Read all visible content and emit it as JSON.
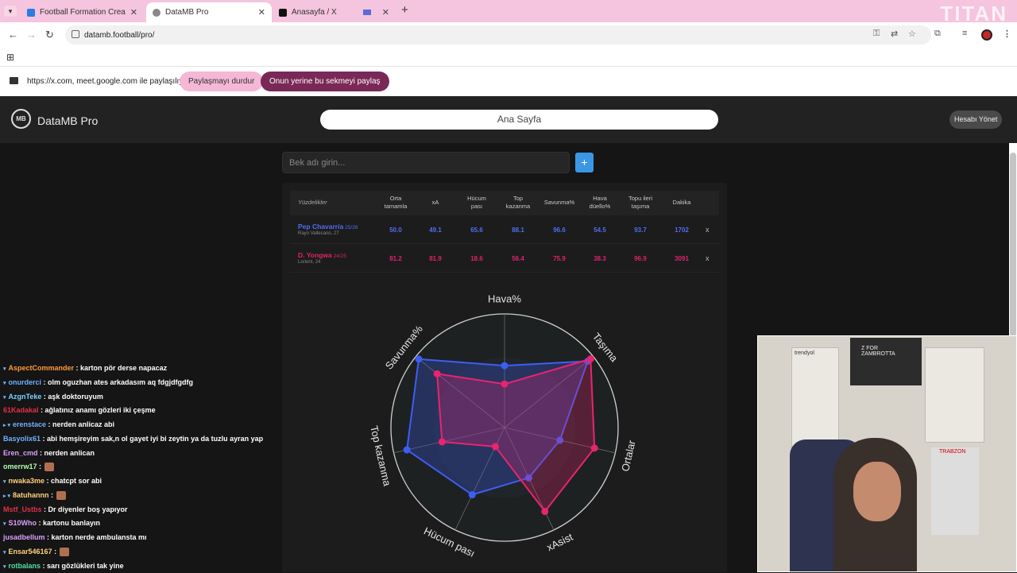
{
  "browser": {
    "tabs": [
      {
        "title": "Football Formation Creator: Re",
        "fav": "#2a7be4",
        "active": false
      },
      {
        "title": "DataMB Pro",
        "fav": "#888888",
        "active": true
      },
      {
        "title": "Anasayfa / X",
        "fav": "#111111",
        "active": false
      }
    ],
    "url": "datamb.football/pro/",
    "watermark": "TITAN"
  },
  "share": {
    "text": "https://x.com, meet.google.com ile paylaşılıyor",
    "stop": "Paylaşmayı durdur",
    "switch": "Onun yerine bu sekmeyi paylaş"
  },
  "site": {
    "logo": "MB",
    "brand": "DataMB Pro",
    "home": "Ana Sayfa",
    "account": "Hesabı Yönet"
  },
  "search": {
    "placeholder": "Bek adı girin...",
    "add": "+"
  },
  "table": {
    "header_first": "Yüzdelikler",
    "columns": [
      "Orta tamamla",
      "xA",
      "Hücum pası",
      "Top kazanma",
      "Savunma%",
      "Hava düello%",
      "Topu ileri taşıma",
      "Dakika"
    ],
    "rows": [
      {
        "name": "Pep Chavarría",
        "season": "25/26",
        "club": "Rayo Vallecano, 27",
        "color": "#4f6ef0",
        "values": [
          "50.0",
          "49.1",
          "65.6",
          "88.1",
          "96.6",
          "54.5",
          "93.7",
          "1702"
        ],
        "remove": "x"
      },
      {
        "name": "D. Yongwa",
        "season": "24/25",
        "club": "Lorient, 24",
        "color": "#e0226e",
        "values": [
          "81.2",
          "81.9",
          "18.6",
          "56.4",
          "75.9",
          "38.3",
          "96.9",
          "3091"
        ],
        "remove": "x"
      }
    ]
  },
  "chart_data": {
    "type": "radar",
    "axes": [
      "Hava%",
      "Taşıma",
      "Ortalar",
      "xAsist",
      "Hücum pası",
      "Top kazanma",
      "Savunma%"
    ],
    "range": [
      0,
      100
    ],
    "series": [
      {
        "name": "Pep Chavarría",
        "color": "#3d5ef5",
        "values": [
          54.5,
          93.7,
          50.0,
          49.1,
          65.6,
          88.1,
          96.6
        ]
      },
      {
        "name": "D. Yongwa",
        "color": "#e8246f",
        "values": [
          38.3,
          96.9,
          81.2,
          81.9,
          18.6,
          56.4,
          75.9
        ]
      }
    ]
  },
  "chat": [
    {
      "user": "AspectCommander",
      "color": "#ff9a3c",
      "text": ": karton pör derse napacaz",
      "mark": "▾"
    },
    {
      "user": "onurderci",
      "color": "#6fb1ff",
      "text": ": olm oguzhan ates arkadasım aq fdgjdfgdfg",
      "mark": "▾"
    },
    {
      "user": "AzgnTeke",
      "color": "#7ad0ff",
      "text": ": aşk doktoruyum",
      "mark": "▾"
    },
    {
      "user": "61Kadakal",
      "color": "#e0304a",
      "text": ": ağlatınız anamı gözleri iki çeşme",
      "mark": ""
    },
    {
      "user": "erenstace",
      "color": "#6fb1ff",
      "text": ": nerden anlicaz abi",
      "mark": "▸ ▾"
    },
    {
      "user": "Basyolix61",
      "color": "#6fb1ff",
      "text": ": abi hemşireyim sak,n ol gayet iyi bi zeytin ya da tuzlu ayran yap",
      "mark": ""
    },
    {
      "user": "Eren_cmd",
      "color": "#d9a0ff",
      "text": ": nerden anlican",
      "mark": ""
    },
    {
      "user": "omerrw17",
      "color": "#b0ffb0",
      "text": ":",
      "mark": "",
      "emoji": true
    },
    {
      "user": "nwaka3me",
      "color": "#ffd27a",
      "text": ": chatcpt sor abi",
      "mark": "▾"
    },
    {
      "user": "8atuhannn",
      "color": "#ffd27a",
      "text": ":",
      "mark": "▸ ▾",
      "emoji": true
    },
    {
      "user": "Mstf_Ustbs",
      "color": "#e0304a",
      "text": ": Dr diyenler boş yapıyor",
      "mark": ""
    },
    {
      "user": "S10Who",
      "color": "#d9a0ff",
      "text": ": kartonu banlayın",
      "mark": "▾"
    },
    {
      "user": "jusadbellum",
      "color": "#d9a0ff",
      "text": ": karton nerde ambulansta mı",
      "mark": ""
    },
    {
      "user": "Ensar546167",
      "color": "#ffd27a",
      "text": ":",
      "mark": "▾",
      "emoji": true
    },
    {
      "user": "rotbalans",
      "color": "#4fe0a0",
      "text": ": sarı gözlükleri tak yine",
      "mark": "▾"
    }
  ],
  "webcam": {
    "text1": "trendyol",
    "text2": "Z FOR ZAMBROTTA",
    "text3": "TRABZON"
  }
}
